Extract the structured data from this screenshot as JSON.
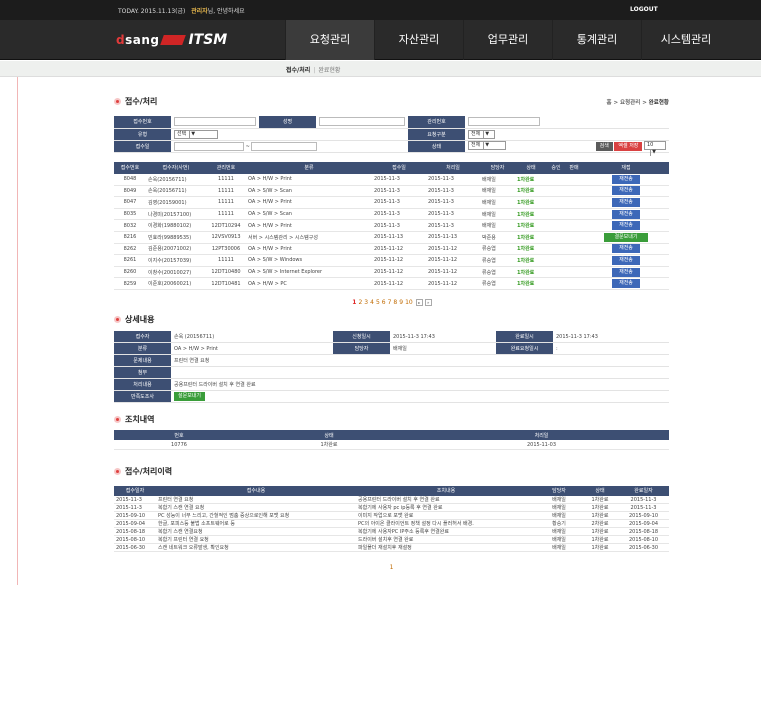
{
  "topbar": {
    "today": "TODAY. 2015.11.13(금)",
    "user": "관리자",
    "greeting": "님, 안녕하세요",
    "logout": "LOGOUT"
  },
  "logo": {
    "brand_a": "d",
    "brand_b": "sang",
    "product": "ITSM"
  },
  "menu": [
    "요청관리",
    "자산관리",
    "업무관리",
    "통계관리",
    "시스템관리"
  ],
  "subnav": {
    "current": "접수/처리",
    "other": "완료현황"
  },
  "section1": {
    "title": "접수/처리",
    "crumbs": [
      "홈",
      "요청관리",
      "완료현황"
    ]
  },
  "search": {
    "labels": {
      "receipt_no": "접수번호",
      "name": "성명",
      "mgmt_no": "관리번호",
      "type": "유형",
      "request_type": "요청구분",
      "receipt_date": "접수일",
      "status": "상태"
    },
    "type_value": "선택",
    "request_value": "전체",
    "status_value": "전체",
    "date_sep": "~",
    "search_btn": "검색",
    "excel_btn": "엑셀 저장",
    "page_size": "10"
  },
  "list": {
    "headers": [
      "접수번호",
      "접수자(사번)",
      "관리번호",
      "분류",
      "접수일",
      "처리일",
      "담당자",
      "상태",
      "승인",
      "판매",
      "재접"
    ],
    "rows": [
      {
        "no": "8048",
        "who": "손욱(20156711)",
        "mgmt": "11111",
        "cat": "OA > H/W > Print",
        "rec": "2015-11-3",
        "proc": "2015-11-3",
        "mgr": "배재일",
        "status": "1차완료",
        "btn": "재전송"
      },
      {
        "no": "8049",
        "who": "손욱(20156711)",
        "mgmt": "11111",
        "cat": "OA > S/W > Scan",
        "rec": "2015-11-3",
        "proc": "2015-11-3",
        "mgr": "배재일",
        "status": "1차완료",
        "btn": "재전송"
      },
      {
        "no": "8047",
        "who": "김영(20159001)",
        "mgmt": "11111",
        "cat": "OA > H/W > Print",
        "rec": "2015-11-3",
        "proc": "2015-11-3",
        "mgr": "배재일",
        "status": "1차완료",
        "btn": "재전송"
      },
      {
        "no": "8035",
        "who": "나경미(20157100)",
        "mgmt": "11111",
        "cat": "OA > S/W > Scan",
        "rec": "2015-11-3",
        "proc": "2015-11-3",
        "mgr": "배재일",
        "status": "1차완료",
        "btn": "재전송"
      },
      {
        "no": "8032",
        "who": "이경화(19880102)",
        "mgmt": "12DT10294",
        "cat": "OA > H/W > Print",
        "rec": "2015-11-3",
        "proc": "2015-11-3",
        "mgr": "배재일",
        "status": "1차완료",
        "btn": "재전송"
      },
      {
        "no": "8216",
        "who": "민효라(99889535)",
        "mgmt": "12VSV0913",
        "cat": "서버 > 시스템관리 > 시스템구성",
        "rec": "2015-11-13",
        "proc": "2015-11-13",
        "mgr": "박준용",
        "status": "1차완료",
        "btn": "결문보내기",
        "green": true
      },
      {
        "no": "8262",
        "who": "김준용(20071002)",
        "mgmt": "12PT30006",
        "cat": "OA > H/W > Print",
        "rec": "2015-11-12",
        "proc": "2015-11-12",
        "mgr": "류승엽",
        "status": "1차완료",
        "btn": "재전송"
      },
      {
        "no": "8261",
        "who": "이지수(20157039)",
        "mgmt": "11111",
        "cat": "OA > S/W > Windows",
        "rec": "2015-11-12",
        "proc": "2015-11-12",
        "mgr": "류승엽",
        "status": "1차완료",
        "btn": "재전송"
      },
      {
        "no": "8260",
        "who": "이창수(20010027)",
        "mgmt": "12DT10480",
        "cat": "OA > S/W > Internet Explorer",
        "rec": "2015-11-12",
        "proc": "2015-11-12",
        "mgr": "류승엽",
        "status": "1차완료",
        "btn": "재전송"
      },
      {
        "no": "8259",
        "who": "이준호(20060021)",
        "mgmt": "12DT10481",
        "cat": "OA > H/W > PC",
        "rec": "2015-11-12",
        "proc": "2015-11-12",
        "mgr": "류승엽",
        "status": "1차완료",
        "btn": "재전송"
      }
    ]
  },
  "pager": {
    "pages": [
      "1",
      "2",
      "3",
      "4",
      "5",
      "6",
      "7",
      "8",
      "9",
      "10"
    ],
    "next": "▸",
    "last": "»"
  },
  "detail": {
    "title": "상세내용",
    "requester_lbl": "접수자",
    "requester": "손욱 (20156711)",
    "req_time_lbl": "신청일시",
    "req_time": "2015-11-3 17:43",
    "done_time_lbl": "완료일시",
    "done_time": "2015-11-3 17:43",
    "category_lbl": "분류",
    "category": "OA > H/W > Print",
    "manager_lbl": "담당자",
    "manager": "배재일",
    "due_lbl": "완료요청일시",
    "due": ":",
    "problem_lbl": "문제내용",
    "problem": "프린터 연결 요청",
    "attach_lbl": "첨부",
    "attach": "",
    "action_lbl": "처리내용",
    "action": "공용프린터 드라이버 설치 후 연결 완료",
    "survey_lbl": "만족도조사",
    "survey_btn": "설문보내기"
  },
  "actions": {
    "title": "조치내역",
    "headers": [
      "번호",
      "상태",
      "처리일"
    ],
    "rows": [
      {
        "no": "10776",
        "status": "1차완료",
        "date": "2015-11-03"
      }
    ]
  },
  "history": {
    "title": "접수/처리이력",
    "headers": [
      "접수일자",
      "접수내용",
      "조치내용",
      "담당자",
      "상태",
      "완료일자"
    ],
    "rows": [
      {
        "date": "2015-11-3",
        "content": "프린터 연결 요청",
        "action": "공용프린터 드라이버 설치 후 연결 완료",
        "mgr": "배재일",
        "status": "1차완료",
        "done": "2015-11-3"
      },
      {
        "date": "2015-11-3",
        "content": "복합기 스캔 연결 요청",
        "action": "복합기에 사용자 pc ip등록 후 연결 완료",
        "mgr": "배재일",
        "status": "1차완료",
        "done": "2015-11-3"
      },
      {
        "date": "2015-09-10",
        "content": "PC 성능이 너무 느리고, 간헐적인 멈춤 증상으로인해 포맷 요청",
        "action": "이미지 작업으로 포맷 완료",
        "mgr": "배재일",
        "status": "1차완료",
        "done": "2015-09-10"
      },
      {
        "date": "2015-09-04",
        "content": "한글, 포피스등 불법 소프트웨어로 등",
        "action": "PC의 아이온 클라이언트 정책 설정 다시 플러허서 배경.",
        "mgr": "황승기",
        "status": "2차완료",
        "done": "2015-09-04"
      },
      {
        "date": "2015-08-18",
        "content": "복합기 스캔 연결요청",
        "action": "복합기에 사용자PC IP주소 등록후 연결완료",
        "mgr": "배재일",
        "status": "1차완료",
        "done": "2015-08-18"
      },
      {
        "date": "2015-08-10",
        "content": "복합기 프린터 연결 요청",
        "action": "드라이버 설치후 연결 완료",
        "mgr": "배재일",
        "status": "1차완료",
        "done": "2015-08-10"
      },
      {
        "date": "2015-06-30",
        "content": "스캔 네트워크 오류발생, 확인요청",
        "action": "파일폴더 재설치후 재설정",
        "mgr": "배재일",
        "status": "1차완료",
        "done": "2015-06-30"
      }
    ],
    "page": "1"
  }
}
